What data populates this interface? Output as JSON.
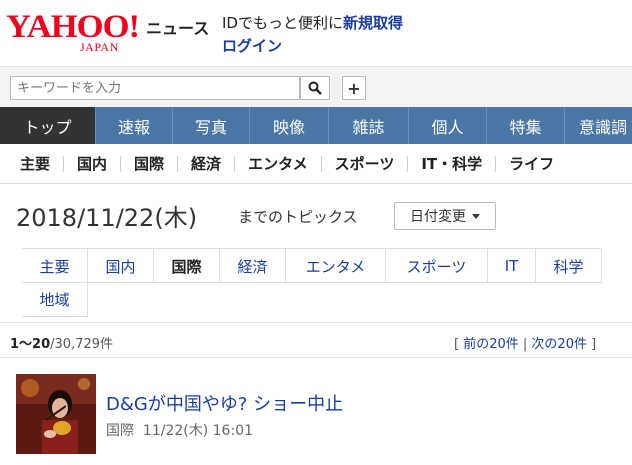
{
  "header": {
    "logo_text": "YAHOO!",
    "logo_sub": "JAPAN",
    "service_name": "ニュース",
    "promo_prefix": "IDでもっと便利に",
    "promo_link": "新規取得",
    "login": "ログイン"
  },
  "search": {
    "placeholder": "キーワードを入力",
    "plus_label": "+"
  },
  "main_nav": [
    {
      "label": "トップ"
    },
    {
      "label": "速報"
    },
    {
      "label": "写真"
    },
    {
      "label": "映像"
    },
    {
      "label": "雑誌"
    },
    {
      "label": "個人"
    },
    {
      "label": "特集"
    },
    {
      "label": "意識調"
    }
  ],
  "sub_nav": [
    {
      "label": "主要"
    },
    {
      "label": "国内"
    },
    {
      "label": "国際"
    },
    {
      "label": "経済"
    },
    {
      "label": "エンタメ"
    },
    {
      "label": "スポーツ"
    },
    {
      "label": "IT・科学"
    },
    {
      "label": "ライフ"
    }
  ],
  "date_section": {
    "date": "2018/11/22(木)",
    "suffix": "までのトピックス",
    "date_button": "日付変更"
  },
  "categories": {
    "row1": [
      {
        "label": "主要"
      },
      {
        "label": "国内"
      },
      {
        "label": "国際"
      },
      {
        "label": "経済"
      },
      {
        "label": "エンタメ"
      },
      {
        "label": "スポーツ"
      },
      {
        "label": "IT"
      },
      {
        "label": "科学"
      }
    ],
    "row2": [
      {
        "label": "地域"
      }
    ]
  },
  "results": {
    "range": "1〜20",
    "total": "/30,729件",
    "pager_open": "[ ",
    "prev": "前の20件",
    "separator": " | ",
    "next": "次の20件",
    "pager_close": " ]"
  },
  "articles": [
    {
      "title": "D&Gが中国やゆ? ショー中止",
      "category": "国際",
      "timestamp": "11/22(木) 16:01"
    }
  ]
}
